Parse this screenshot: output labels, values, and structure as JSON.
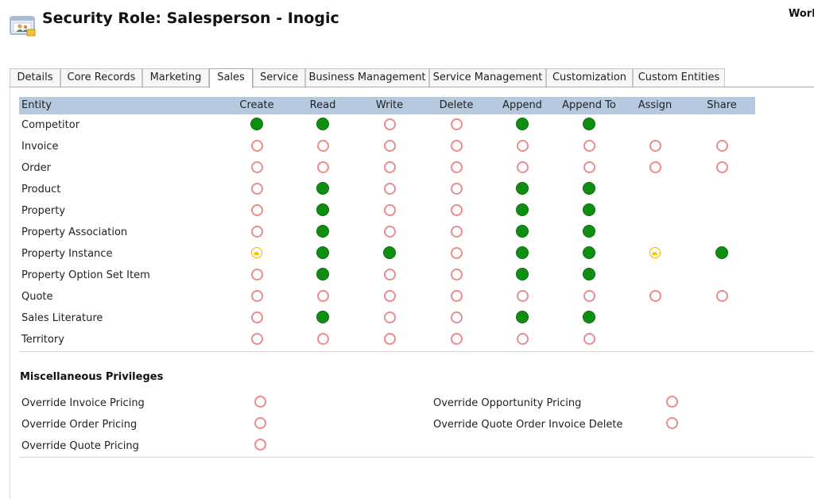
{
  "window": {
    "title": "Security Role: Salesperson - Inogic",
    "work_link": "Work"
  },
  "tabs": [
    "Details",
    "Core Records",
    "Marketing",
    "Sales",
    "Service",
    "Business Management",
    "Service Management",
    "Customization",
    "Custom Entities"
  ],
  "active_tab": "Sales",
  "grid": {
    "entity_header": "Entity",
    "columns": [
      "Create",
      "Read",
      "Write",
      "Delete",
      "Append",
      "Append To",
      "Assign",
      "Share"
    ],
    "rows": [
      {
        "name": "Competitor",
        "levels": [
          "org",
          "org",
          "none",
          "none",
          "org",
          "org",
          null,
          null
        ]
      },
      {
        "name": "Invoice",
        "levels": [
          "none",
          "none",
          "none",
          "none",
          "none",
          "none",
          "none",
          "none"
        ]
      },
      {
        "name": "Order",
        "levels": [
          "none",
          "none",
          "none",
          "none",
          "none",
          "none",
          "none",
          "none"
        ]
      },
      {
        "name": "Product",
        "levels": [
          "none",
          "org",
          "none",
          "none",
          "org",
          "org",
          null,
          null
        ]
      },
      {
        "name": "Property",
        "levels": [
          "none",
          "org",
          "none",
          "none",
          "org",
          "org",
          null,
          null
        ]
      },
      {
        "name": "Property Association",
        "levels": [
          "none",
          "org",
          "none",
          "none",
          "org",
          "org",
          null,
          null
        ]
      },
      {
        "name": "Property Instance",
        "levels": [
          "user",
          "org",
          "org",
          "none",
          "org",
          "org",
          "user",
          "org"
        ]
      },
      {
        "name": "Property Option Set Item",
        "levels": [
          "none",
          "org",
          "none",
          "none",
          "org",
          "org",
          null,
          null
        ]
      },
      {
        "name": "Quote",
        "levels": [
          "none",
          "none",
          "none",
          "none",
          "none",
          "none",
          "none",
          "none"
        ]
      },
      {
        "name": "Sales Literature",
        "levels": [
          "none",
          "org",
          "none",
          "none",
          "org",
          "org",
          null,
          null
        ]
      },
      {
        "name": "Territory",
        "levels": [
          "none",
          "none",
          "none",
          "none",
          "none",
          "none",
          null,
          null
        ]
      }
    ]
  },
  "misc": {
    "title": "Miscellaneous Privileges",
    "items": [
      {
        "name": "Override Invoice Pricing",
        "level": "none"
      },
      {
        "name": "Override Order Pricing",
        "level": "none"
      },
      {
        "name": "Override Quote Pricing",
        "level": "none"
      },
      {
        "name": "Override Opportunity Pricing",
        "level": "none"
      },
      {
        "name": "Override Quote Order Invoice Delete",
        "level": "none"
      }
    ]
  },
  "colors": {
    "org_level": "#0e8f12",
    "none_level": "#ea8c8c",
    "user_level": "#f8c400",
    "grid_header_bg": "#b7c9df"
  },
  "icons": {
    "role": "security-role-icon",
    "none": "empty-circle-icon",
    "org": "filled-green-circle-icon",
    "user": "yellow-half-circle-icon"
  }
}
